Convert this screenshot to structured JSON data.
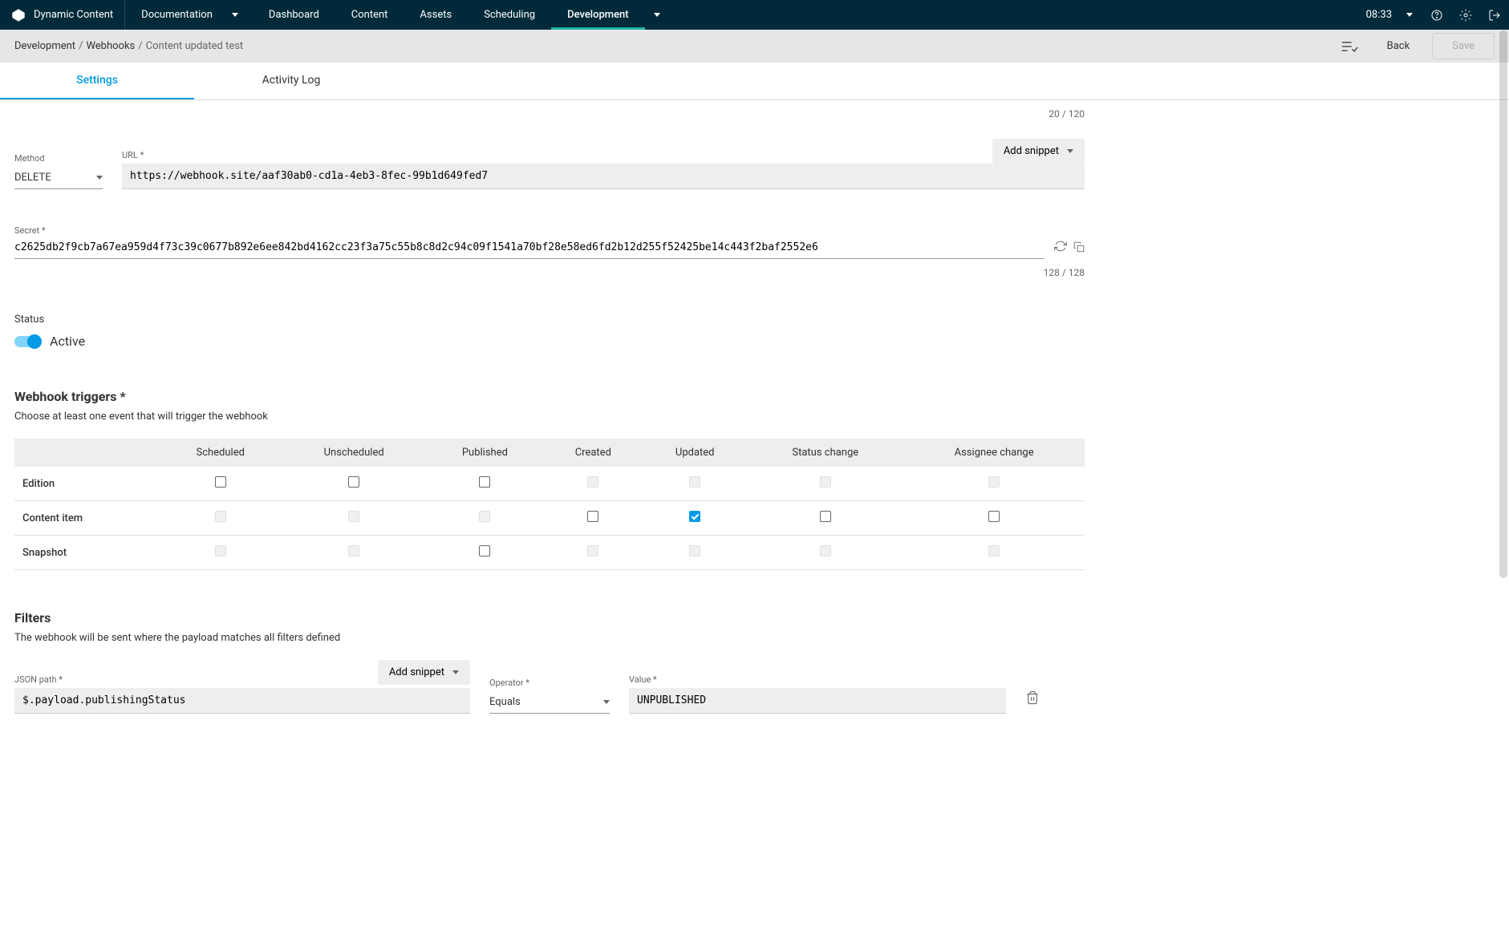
{
  "brand": "Dynamic Content",
  "doc_dropdown": "Documentation",
  "nav": {
    "dashboard": "Dashboard",
    "content": "Content",
    "assets": "Assets",
    "scheduling": "Scheduling",
    "development": "Development"
  },
  "time": "08:33",
  "breadcrumb": {
    "root": "Development",
    "parent": "Webhooks",
    "current": "Content updated test"
  },
  "actions": {
    "back": "Back",
    "save": "Save"
  },
  "tabs": {
    "settings": "Settings",
    "activity": "Activity Log"
  },
  "url_counter": "20 / 120",
  "method": {
    "label": "Method",
    "value": "DELETE"
  },
  "url": {
    "label": "URL *",
    "value": "https://webhook.site/aaf30ab0-cd1a-4eb3-8fec-99b1d649fed7"
  },
  "add_snippet": "Add snippet",
  "secret": {
    "label": "Secret *",
    "value": "c2625db2f9cb7a67ea959d4f73c39c0677b892e6ee842bd4162cc23f3a75c55b8c8d2c94c09f1541a70bf28e58ed6fd2b12d255f52425be14c443f2baf2552e6",
    "counter": "128 / 128"
  },
  "status": {
    "label": "Status",
    "value": "Active"
  },
  "triggers": {
    "heading": "Webhook triggers *",
    "sub": "Choose at least one event that will trigger the webhook",
    "columns": [
      "Scheduled",
      "Unscheduled",
      "Published",
      "Created",
      "Updated",
      "Status change",
      "Assignee change"
    ],
    "rows": [
      {
        "label": "Edition",
        "cells": [
          "unchecked",
          "unchecked",
          "unchecked",
          "disabled",
          "disabled",
          "disabled",
          "disabled"
        ]
      },
      {
        "label": "Content item",
        "cells": [
          "disabled",
          "disabled",
          "disabled",
          "unchecked",
          "checked",
          "unchecked",
          "unchecked"
        ]
      },
      {
        "label": "Snapshot",
        "cells": [
          "disabled",
          "disabled",
          "unchecked",
          "disabled",
          "disabled",
          "disabled",
          "disabled"
        ]
      }
    ]
  },
  "filters": {
    "heading": "Filters",
    "sub": "The webhook will be sent where the payload matches all filters defined",
    "jsonpath_label": "JSON path *",
    "jsonpath_value": "$.payload.publishingStatus",
    "operator_label": "Operator *",
    "operator_value": "Equals",
    "value_label": "Value *",
    "value_value": "UNPUBLISHED"
  }
}
